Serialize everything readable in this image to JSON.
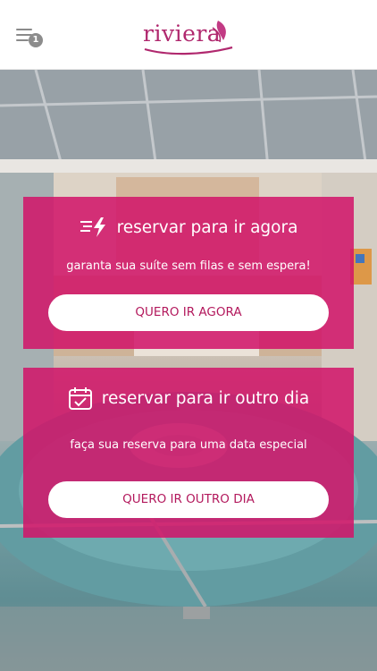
{
  "header": {
    "menu_badge": "1",
    "logo_text": "riviera"
  },
  "cards": [
    {
      "title": "reservar para ir agora",
      "subtitle": "garanta sua suíte sem filas e sem espera!",
      "button": "QUERO IR AGORA",
      "icon": "lightning-icon"
    },
    {
      "title": "reservar para ir outro dia",
      "subtitle": "faça sua reserva para uma data especial",
      "button": "QUERO IR OUTRO DIA",
      "icon": "calendar-check-icon"
    }
  ],
  "colors": {
    "brand": "#b0286e",
    "card_bg": "#d21469",
    "button_text": "#b3195d"
  }
}
